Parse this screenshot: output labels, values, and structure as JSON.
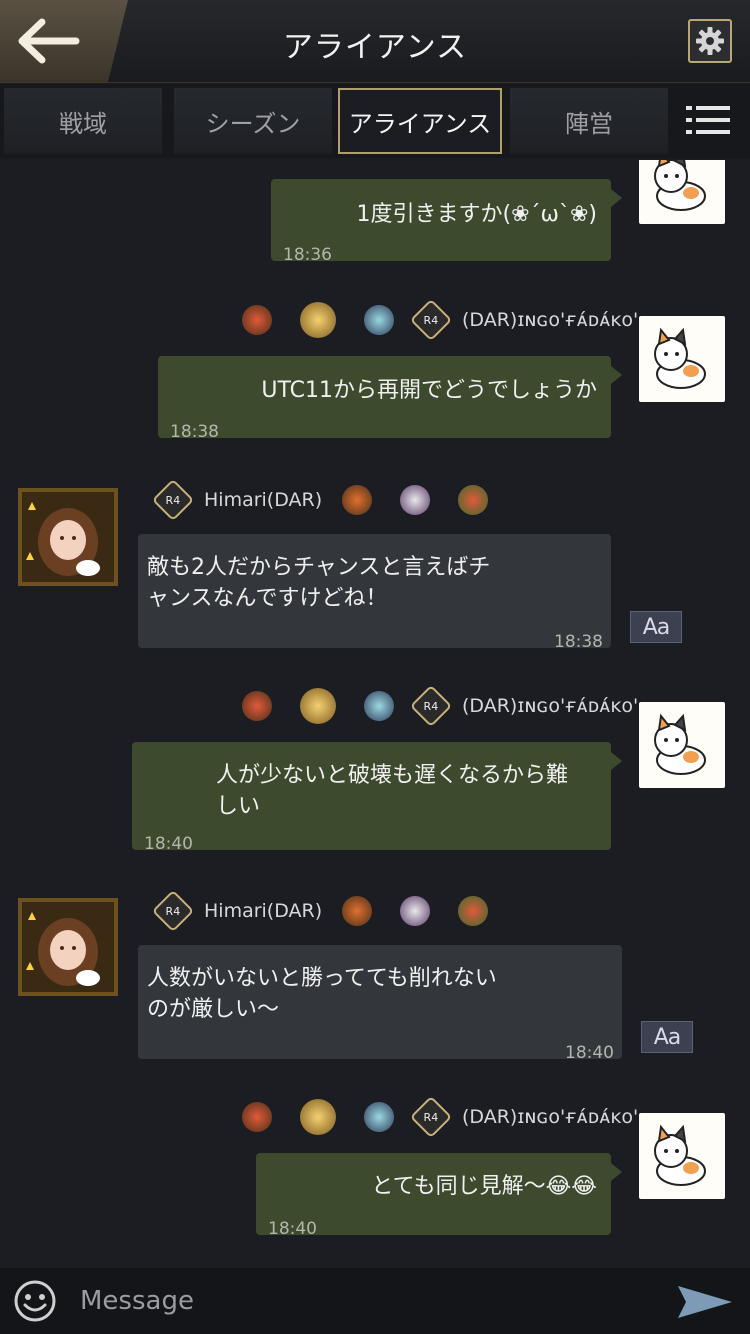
{
  "header": {
    "title": "アライアンス",
    "back_icon": "back-arrow-icon",
    "settings_icon": "gear-icon"
  },
  "tabs": [
    {
      "label": "戦域",
      "active": false
    },
    {
      "label": "シーズン",
      "active": false
    },
    {
      "label": "アライアンス",
      "active": true
    },
    {
      "label": "陣営",
      "active": false
    }
  ],
  "menu_icon": "list-menu-icon",
  "messages": [
    {
      "side": "mine",
      "text": "1度引きますか(❀´ω`❀)",
      "time": "18:36"
    },
    {
      "side": "mine",
      "sender": "(DAR)ɪɴɢᴏ'ғᴀ́ᴅᴀ́ᴋᴏ'",
      "rank": "R4",
      "text": "UTC11から再開でどうでしょうか",
      "time": "18:38"
    },
    {
      "side": "theirs",
      "sender": "Himari(DAR)",
      "rank": "R4",
      "text_lines": [
        "敵も2人だからチャンスと言えばチ",
        "ャンスなんですけどね！"
      ],
      "time": "18:38",
      "translate_label": "Aa"
    },
    {
      "side": "mine",
      "sender": "(DAR)ɪɴɢᴏ'ғᴀ́ᴅᴀ́ᴋᴏ'",
      "rank": "R4",
      "text_lines": [
        "人が少ないと破壊も遅くなるから難",
        "しい"
      ],
      "time": "18:40"
    },
    {
      "side": "theirs",
      "sender": "Himari(DAR)",
      "rank": "R4",
      "text_lines": [
        "人数がいないと勝ってても削れない",
        "のが厳しい〜"
      ],
      "time": "18:40",
      "translate_label": "Aa"
    },
    {
      "side": "mine",
      "sender": "(DAR)ɪɴɢᴏ'ғᴀ́ᴅᴀ́ᴋᴏ'",
      "rank": "R4",
      "text": "とても同じ見解〜😂😂",
      "time": "18:40"
    }
  ],
  "input": {
    "placeholder": "Message",
    "emoji_icon": "smiley-icon",
    "send_icon": "send-arrow-icon"
  },
  "colors": {
    "mine_bubble": "#3d4a2e",
    "theirs_bubble": "#33363b",
    "accent_gold": "#b19e6f"
  }
}
